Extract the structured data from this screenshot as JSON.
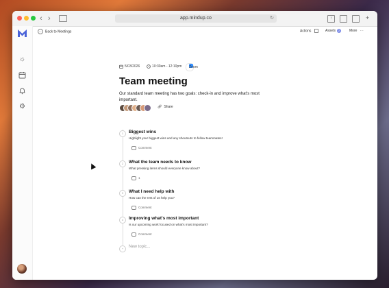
{
  "browser": {
    "url": "app.mindup.co"
  },
  "sidebar": {
    "icons": [
      "sun-icon",
      "calendar-icon",
      "bell-icon",
      "gear-icon"
    ]
  },
  "topbar": {
    "back_label": "Back to Meetings",
    "actions_label": "Actions",
    "assets_label": "Assets",
    "assets_count": "2",
    "more_label": "More"
  },
  "meeting": {
    "date": "5/03/2026",
    "time": "10:30am - 12:10pm",
    "platform": "Zoom",
    "title": "Team meeting",
    "description": "Our standard team meeting has two goals: check-in and improve what's most important.",
    "share_label": "Share"
  },
  "topics": [
    {
      "number": "1",
      "title": "Biggest wins",
      "subtitle": "Highlight your biggest wins and any shoutouts to fellow teammates!",
      "comment": "Comment"
    },
    {
      "number": "2",
      "title": "What the team needs to know",
      "subtitle": "What pressing items should everyone know about?",
      "comment": "1"
    },
    {
      "number": "3",
      "title": "What I need help with",
      "subtitle": "How can the rest of us help you?",
      "comment": "Comment"
    },
    {
      "number": "4",
      "title": "Improving what's most important",
      "subtitle": "Is our upcoming work focused on what's most important?",
      "comment": "Comment"
    }
  ],
  "new_topic_placeholder": "New topic...",
  "colors": {
    "accent": "#4a63d8",
    "badge": "#7d8ce8",
    "zoom": "#2d8cff"
  }
}
